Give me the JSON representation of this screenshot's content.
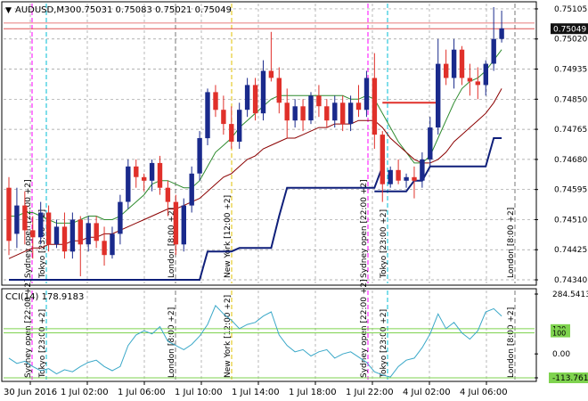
{
  "header": {
    "symbol_label": "AUDUSD,M30",
    "ohlc": "0.75031 0.75083 0.75021 0.75049"
  },
  "colors": {
    "background": "#ffffff",
    "grid": "#9a9a9a",
    "bull": "#1a2a8c",
    "bear": "#e0302a",
    "ma_fast": "#2e8b2e",
    "ma_slow": "#8b0000",
    "level_line": "#0f1f7a",
    "cci_line": "#3aa8c8",
    "cci_level": "#7fd34f",
    "session_sydney": "#ff00ff",
    "session_tokyo": "#00bcd4",
    "session_london": "#777777",
    "session_newyork": "#e0c000",
    "price_tag": "#111111",
    "hline_red": "#e05050"
  },
  "price_axis": {
    "current": "0.75049",
    "labels": [
      "0.75105",
      "0.75020",
      "0.74935",
      "0.74850",
      "0.74765",
      "0.74680",
      "0.74595",
      "0.74510",
      "0.74425",
      "0.74340"
    ]
  },
  "cci": {
    "label": "CCI(14) 178.9183",
    "axis_labels": [
      "284.5413",
      "0.00",
      "-113.761"
    ],
    "level_tags": [
      "120",
      "100"
    ]
  },
  "time_axis": {
    "labels": [
      "30 Jun 2016",
      "1 Jul 02:00",
      "1 Jul 06:00",
      "1 Jul 10:00",
      "1 Jul 14:00",
      "1 Jul 18:00",
      "1 Jul 22:00",
      "4 Jul 02:00",
      "4 Jul 06:00"
    ]
  },
  "sessions": [
    {
      "name": "Sydney open",
      "offset": "[22:00 +2]"
    },
    {
      "name": "Tokyo",
      "offset": "[23:00 +2]"
    },
    {
      "name": "London",
      "offset": "[8:00 +2]"
    },
    {
      "name": "New York",
      "offset": "[12:00 +2]"
    },
    {
      "name": "Sydney open",
      "offset": "[22:00 +2]"
    },
    {
      "name": "Tokyo",
      "offset": "[23:00 +2]"
    },
    {
      "name": "London",
      "offset": "[8:00 +2]"
    }
  ],
  "chart_data": {
    "type": "candlestick",
    "title": "AUDUSD,M30",
    "ylim": [
      0.7433,
      0.7512
    ],
    "candles": [
      [
        0.746,
        0.7463,
        0.7441,
        0.7445
      ],
      [
        0.7447,
        0.746,
        0.7443,
        0.7455
      ],
      [
        0.7455,
        0.7459,
        0.7444,
        0.7448
      ],
      [
        0.7448,
        0.7452,
        0.744,
        0.7446
      ],
      [
        0.7446,
        0.7456,
        0.7444,
        0.7453
      ],
      [
        0.7453,
        0.7455,
        0.7442,
        0.7444
      ],
      [
        0.7444,
        0.7451,
        0.7443,
        0.7449
      ],
      [
        0.7449,
        0.7453,
        0.744,
        0.7442
      ],
      [
        0.7442,
        0.7453,
        0.744,
        0.7451
      ],
      [
        0.7451,
        0.7452,
        0.7435,
        0.7444
      ],
      [
        0.7444,
        0.7452,
        0.7442,
        0.745
      ],
      [
        0.745,
        0.7452,
        0.7443,
        0.7445
      ],
      [
        0.7445,
        0.7449,
        0.7438,
        0.7441
      ],
      [
        0.7441,
        0.7449,
        0.744,
        0.7447
      ],
      [
        0.7447,
        0.7458,
        0.7444,
        0.7456
      ],
      [
        0.7456,
        0.7468,
        0.7454,
        0.7466
      ],
      [
        0.7466,
        0.7468,
        0.746,
        0.7463
      ],
      [
        0.7463,
        0.7464,
        0.7459,
        0.7462
      ],
      [
        0.7462,
        0.7468,
        0.7459,
        0.7467
      ],
      [
        0.7467,
        0.7469,
        0.7458,
        0.746
      ],
      [
        0.746,
        0.7462,
        0.7452,
        0.7456
      ],
      [
        0.7456,
        0.7458,
        0.7441,
        0.7444
      ],
      [
        0.7444,
        0.7457,
        0.7442,
        0.7455
      ],
      [
        0.7455,
        0.7466,
        0.7453,
        0.7464
      ],
      [
        0.7464,
        0.7476,
        0.7462,
        0.7474
      ],
      [
        0.7474,
        0.7488,
        0.7472,
        0.7487
      ],
      [
        0.7487,
        0.7489,
        0.748,
        0.7482
      ],
      [
        0.7482,
        0.7486,
        0.7475,
        0.7478
      ],
      [
        0.7478,
        0.7483,
        0.7471,
        0.7473
      ],
      [
        0.7473,
        0.7484,
        0.7471,
        0.7482
      ],
      [
        0.7482,
        0.7491,
        0.748,
        0.7489
      ],
      [
        0.7489,
        0.7491,
        0.7479,
        0.7481
      ],
      [
        0.7481,
        0.7496,
        0.7479,
        0.7493
      ],
      [
        0.7493,
        0.7504,
        0.749,
        0.7491
      ],
      [
        0.7491,
        0.7494,
        0.7481,
        0.7484
      ],
      [
        0.7484,
        0.7488,
        0.7474,
        0.7479
      ],
      [
        0.7479,
        0.7485,
        0.7477,
        0.7483
      ],
      [
        0.7483,
        0.7485,
        0.7476,
        0.7479
      ],
      [
        0.7479,
        0.7487,
        0.7478,
        0.7486
      ],
      [
        0.7486,
        0.7489,
        0.748,
        0.7483
      ],
      [
        0.7483,
        0.7485,
        0.7477,
        0.7479
      ],
      [
        0.7479,
        0.7486,
        0.7477,
        0.7484
      ],
      [
        0.7484,
        0.7486,
        0.7476,
        0.7478
      ],
      [
        0.7478,
        0.7486,
        0.7476,
        0.7484
      ],
      [
        0.7484,
        0.7489,
        0.748,
        0.7482
      ],
      [
        0.7482,
        0.7493,
        0.748,
        0.7491
      ],
      [
        0.7491,
        0.7498,
        0.7471,
        0.7475
      ],
      [
        0.7475,
        0.7476,
        0.7456,
        0.7461
      ],
      [
        0.7461,
        0.7466,
        0.746,
        0.7465
      ],
      [
        0.7465,
        0.7468,
        0.7461,
        0.7462
      ],
      [
        0.7462,
        0.7464,
        0.746,
        0.7463
      ],
      [
        0.7463,
        0.7466,
        0.7457,
        0.7462
      ],
      [
        0.7462,
        0.747,
        0.746,
        0.7468
      ],
      [
        0.7468,
        0.748,
        0.7466,
        0.7477
      ],
      [
        0.7477,
        0.7502,
        0.7475,
        0.7495
      ],
      [
        0.7495,
        0.7499,
        0.7489,
        0.7491
      ],
      [
        0.7491,
        0.7502,
        0.7488,
        0.7499
      ],
      [
        0.7499,
        0.75,
        0.7489,
        0.7491
      ],
      [
        0.7491,
        0.7495,
        0.7486,
        0.749
      ],
      [
        0.749,
        0.7494,
        0.7485,
        0.7489
      ],
      [
        0.7489,
        0.7496,
        0.7486,
        0.7495
      ],
      [
        0.7495,
        0.7511,
        0.7493,
        0.7502
      ],
      [
        0.7502,
        0.751,
        0.7501,
        0.7505
      ]
    ],
    "ma_fast": [
      0.7452,
      0.7452,
      0.7453,
      0.7453,
      0.7452,
      0.7451,
      0.745,
      0.745,
      0.745,
      0.7451,
      0.7452,
      0.7452,
      0.7451,
      0.7451,
      0.7452,
      0.7454,
      0.7456,
      0.7458,
      0.7461,
      0.7462,
      0.7462,
      0.7461,
      0.746,
      0.746,
      0.7462,
      0.7466,
      0.747,
      0.7472,
      0.7474,
      0.7477,
      0.7479,
      0.7481,
      0.7483,
      0.7485,
      0.7486,
      0.7486,
      0.7486,
      0.7486,
      0.7486,
      0.7486,
      0.7486,
      0.7486,
      0.7486,
      0.7485,
      0.7485,
      0.7486,
      0.7485,
      0.7481,
      0.7477,
      0.7473,
      0.747,
      0.7467,
      0.7467,
      0.7469,
      0.7474,
      0.7479,
      0.7484,
      0.7488,
      0.749,
      0.7491,
      0.7493,
      0.7496,
      0.7499
    ],
    "ma_slow": [
      0.744,
      0.7441,
      0.7442,
      0.7443,
      0.7443,
      0.7444,
      0.7444,
      0.7444,
      0.7445,
      0.7445,
      0.7446,
      0.7446,
      0.7447,
      0.7447,
      0.7448,
      0.7449,
      0.745,
      0.7451,
      0.7452,
      0.7453,
      0.7454,
      0.7454,
      0.7455,
      0.7456,
      0.7457,
      0.7459,
      0.7461,
      0.7463,
      0.7464,
      0.7466,
      0.7468,
      0.7469,
      0.7471,
      0.7472,
      0.7473,
      0.7474,
      0.7474,
      0.7475,
      0.7476,
      0.7477,
      0.7477,
      0.7478,
      0.7478,
      0.7478,
      0.7479,
      0.7479,
      0.7479,
      0.7477,
      0.7474,
      0.7472,
      0.747,
      0.7468,
      0.7467,
      0.7467,
      0.7468,
      0.747,
      0.7473,
      0.7475,
      0.7477,
      0.7479,
      0.7481,
      0.7484,
      0.7488
    ],
    "level_line": [
      [
        0.7434,
        0.7434,
        0.7434,
        0.7434,
        0.7434,
        0.7434,
        0.7434,
        0.7434,
        0.7434,
        0.7434,
        0.7434,
        0.7434,
        0.7434,
        0.7434,
        0.7434,
        0.7434,
        0.7434,
        0.7434,
        0.7434,
        0.7434,
        0.7434,
        0.7434,
        0.7434,
        0.7434,
        0.7434,
        0.7442,
        0.7442,
        0.7442,
        0.7442,
        0.7443,
        0.7443,
        0.7443,
        0.7443,
        0.7443,
        0.7452,
        0.746,
        0.746,
        0.746,
        0.746,
        0.746,
        0.746,
        0.746,
        0.746,
        0.746,
        0.746,
        0.746,
        0.746,
        0.7466
      ],
      [
        0.7459,
        0.7459,
        0.7459,
        0.7459,
        0.7459,
        0.7462,
        0.7462,
        0.7466,
        0.7466,
        0.7466,
        0.7466,
        0.7466,
        0.7466,
        0.7466,
        0.7466,
        0.7474,
        0.7474
      ]
    ],
    "red_hline": {
      "value": 0.7484,
      "from_bar": 47,
      "to_bar": 54
    },
    "cci_values": [
      -20,
      -45,
      -35,
      -60,
      -80,
      -70,
      -95,
      -75,
      -85,
      -60,
      -40,
      -30,
      -60,
      -80,
      -60,
      40,
      90,
      110,
      95,
      130,
      60,
      40,
      20,
      45,
      85,
      140,
      230,
      190,
      160,
      120,
      140,
      150,
      180,
      200,
      90,
      40,
      10,
      20,
      -10,
      10,
      20,
      -20,
      0,
      10,
      -15,
      -40,
      -85,
      -100,
      -110,
      -60,
      -30,
      -20,
      30,
      95,
      190,
      120,
      150,
      100,
      70,
      110,
      200,
      215,
      180
    ],
    "cci_levels": [
      120,
      100
    ],
    "cci_ylim": [
      -113.761,
      284.5413
    ]
  }
}
